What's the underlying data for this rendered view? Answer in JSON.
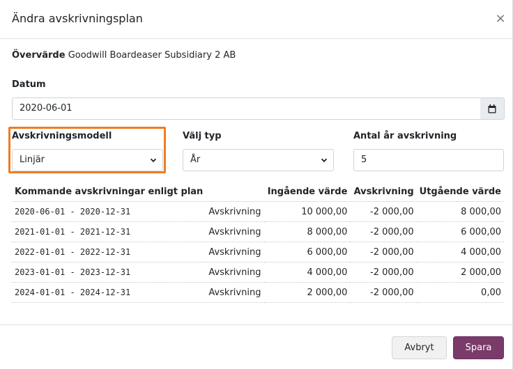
{
  "dialog": {
    "title": "Ändra avskrivningsplan",
    "close_symbol": "×"
  },
  "overvarde": {
    "label": "Övervärde",
    "value": "Goodwill Boardeaser Subsidiary 2 AB"
  },
  "datum": {
    "label": "Datum",
    "value": "2020-06-01",
    "icon": "calendar-icon"
  },
  "model": {
    "label": "Avskrivningsmodell",
    "selected": "Linjär"
  },
  "type": {
    "label": "Välj typ",
    "selected": "År"
  },
  "years": {
    "label": "Antal år avskrivning",
    "value": "5"
  },
  "table": {
    "headers": [
      "Kommande avskrivningar enligt plan",
      "",
      "Ingående värde",
      "Avskrivning",
      "Utgående värde"
    ],
    "rows": [
      {
        "period": "2020-06-01 - 2020-12-31",
        "type": "Avskrivning",
        "in": "10 000,00",
        "dep": "-2 000,00",
        "out": "8 000,00"
      },
      {
        "period": "2021-01-01 - 2021-12-31",
        "type": "Avskrivning",
        "in": "8 000,00",
        "dep": "-2 000,00",
        "out": "6 000,00"
      },
      {
        "period": "2022-01-01 - 2022-12-31",
        "type": "Avskrivning",
        "in": "6 000,00",
        "dep": "-2 000,00",
        "out": "4 000,00"
      },
      {
        "period": "2023-01-01 - 2023-12-31",
        "type": "Avskrivning",
        "in": "4 000,00",
        "dep": "-2 000,00",
        "out": "2 000,00"
      },
      {
        "period": "2024-01-01 - 2024-12-31",
        "type": "Avskrivning",
        "in": "2 000,00",
        "dep": "-2 000,00",
        "out": "0,00"
      }
    ]
  },
  "footer": {
    "cancel_label": "Avbryt",
    "save_label": "Spara"
  },
  "colors": {
    "primary": "#7a3b6b",
    "highlight": "#f07c22"
  }
}
